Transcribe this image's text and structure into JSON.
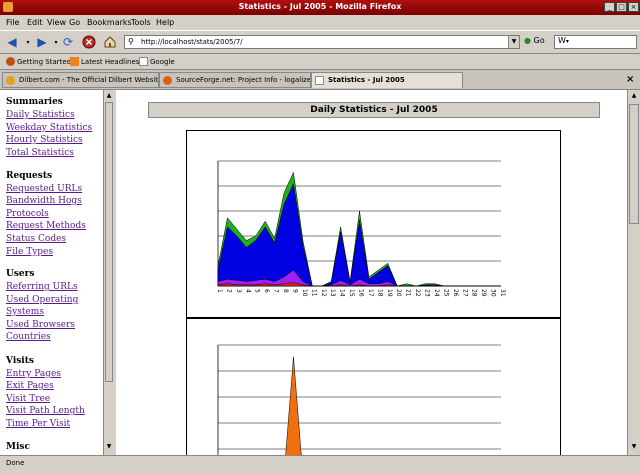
{
  "window": {
    "title": "Statistics - Jul 2005 - Mozilla Firefox"
  },
  "menu": [
    "File",
    "Edit",
    "View",
    "Go",
    "Bookmarks",
    "Tools",
    "Help"
  ],
  "navbar": {
    "url": "http://localhost/stats/2005/7/",
    "go_label": "Go",
    "search_value": "W"
  },
  "bookmarks": [
    "Getting Started",
    "Latest Headlines",
    "Google"
  ],
  "tabs": [
    {
      "label": "Dilbert.com - The Official Dilbert Website by...",
      "active": false
    },
    {
      "label": "SourceForge.net: Project Info - logalizer",
      "active": false
    },
    {
      "label": "Statistics - Jul 2005",
      "active": true
    }
  ],
  "sidebar": {
    "sections": [
      {
        "heading": "Summaries",
        "links": [
          "Daily Statistics",
          "Weekday Statistics",
          "Hourly Statistics",
          "Total Statistics"
        ]
      },
      {
        "heading": "Requests",
        "links": [
          "Requested URLs",
          "Bandwidth Hogs",
          "Protocols",
          "Request Methods",
          "Status Codes",
          "File Types"
        ]
      },
      {
        "heading": "Users",
        "links": [
          "Referring URLs",
          "Used Operating",
          "Systems",
          "Used Browsers",
          "Countries"
        ]
      },
      {
        "heading": "Visits",
        "links": [
          "Entry Pages",
          "Exit Pages",
          "Visit Tree",
          "Visit Path Length",
          "Time Per Visit"
        ]
      },
      {
        "heading": "Misc",
        "links": []
      }
    ]
  },
  "page": {
    "heading": "Daily Statistics - Jul 2005"
  },
  "status": {
    "text": "Done"
  },
  "chart_data": [
    {
      "type": "area",
      "categories": [
        "1",
        "2",
        "3",
        "4",
        "5",
        "6",
        "7",
        "8",
        "9",
        "10",
        "11",
        "12",
        "13",
        "14",
        "15",
        "16",
        "17",
        "18",
        "19",
        "20",
        "21",
        "22",
        "23",
        "24",
        "25",
        "26",
        "27",
        "28",
        "29",
        "30",
        "31"
      ],
      "series": [
        {
          "color": "#1fb01f",
          "values": [
            18,
            60,
            50,
            40,
            44,
            57,
            42,
            82,
            100,
            40,
            0,
            0,
            4,
            52,
            4,
            66,
            8,
            14,
            20,
            0,
            2,
            0,
            2,
            2,
            0,
            0,
            0,
            0,
            0,
            0,
            0
          ]
        },
        {
          "color": "#0000e0",
          "values": [
            14,
            52,
            44,
            34,
            40,
            52,
            38,
            72,
            90,
            36,
            0,
            0,
            3,
            48,
            3,
            58,
            6,
            12,
            18,
            0,
            0,
            0,
            1,
            1,
            0,
            0,
            0,
            0,
            0,
            0,
            0
          ]
        },
        {
          "color": "#a020f0",
          "values": [
            4,
            6,
            5,
            4,
            5,
            6,
            4,
            8,
            14,
            4,
            0,
            0,
            1,
            5,
            1,
            6,
            2,
            2,
            4,
            0,
            0,
            0,
            0,
            0,
            0,
            0,
            0,
            0,
            0,
            0,
            0
          ]
        },
        {
          "color": "#e02020",
          "values": [
            1,
            2,
            1,
            1,
            1,
            2,
            1,
            2,
            3,
            1,
            0,
            0,
            0,
            1,
            0,
            1,
            0,
            0,
            1,
            0,
            0,
            0,
            0,
            0,
            0,
            0,
            0,
            0,
            0,
            0,
            0
          ]
        }
      ],
      "ylim": [
        0,
        110
      ]
    },
    {
      "type": "area",
      "series": [
        {
          "color": "#f07010",
          "values": [
            0,
            0,
            0,
            0,
            8,
            0,
            0,
            0,
            100,
            0,
            0,
            0,
            0,
            0,
            0,
            0,
            0,
            0,
            0,
            0,
            0,
            0,
            0,
            0,
            0,
            0,
            0,
            0,
            0,
            0,
            0
          ]
        }
      ],
      "ylim": [
        0,
        110
      ]
    }
  ],
  "colors": {
    "titlebar": "#9a0a0a",
    "visited_link": "#5a1a8a"
  }
}
